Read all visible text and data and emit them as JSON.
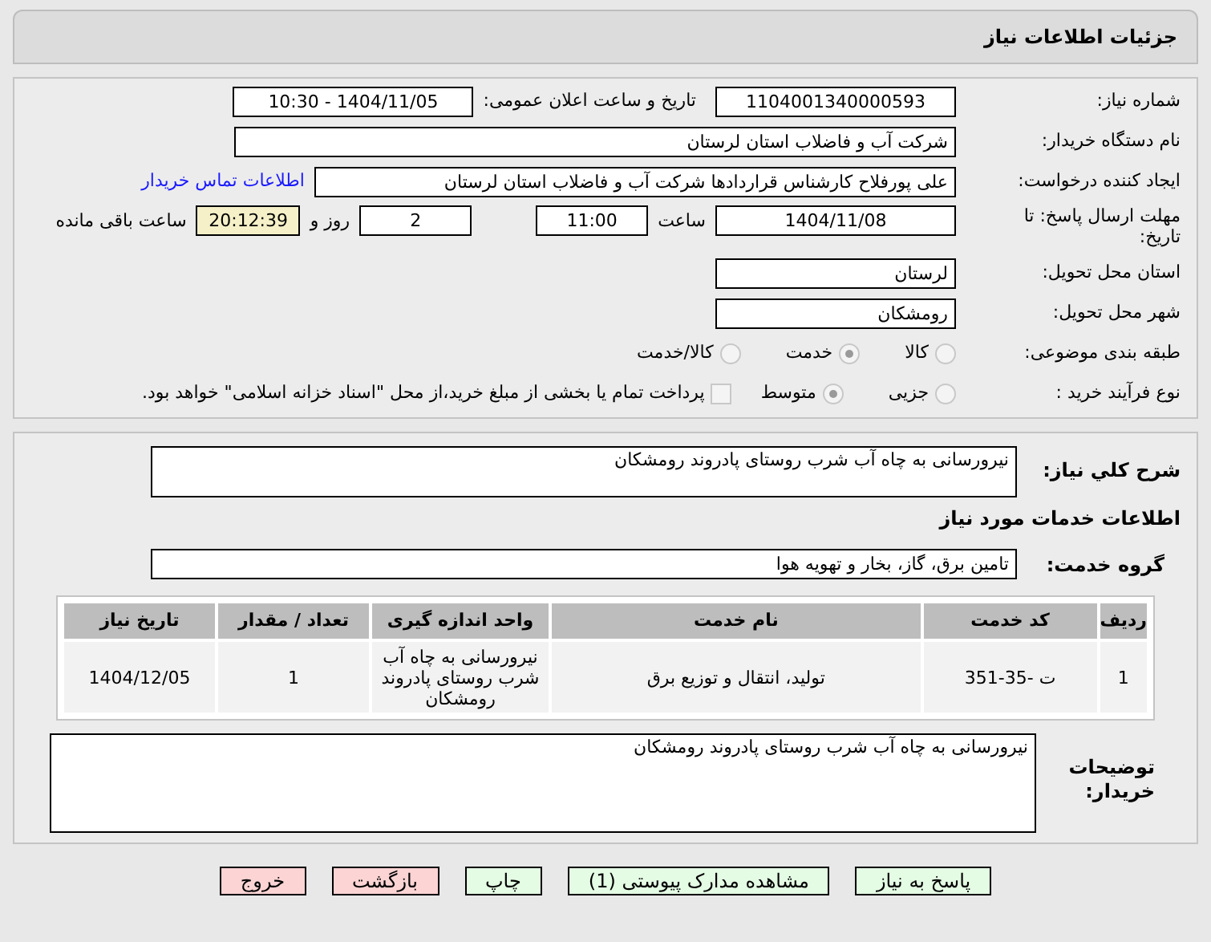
{
  "header": {
    "title": "جزئیات اطلاعات نیاز"
  },
  "fields": {
    "need_number": {
      "label": "شماره نیاز:",
      "value": "1104001340000593"
    },
    "announce": {
      "label": "تاریخ و ساعت اعلان عمومی:",
      "value": "1404/11/05 - 10:30"
    },
    "buyer": {
      "label": "نام دستگاه خریدار:",
      "value": "شرکت آب و فاضلاب استان لرستان"
    },
    "creator": {
      "label": "ایجاد کننده درخواست:",
      "value": "علی پورفلاح کارشناس قراردادها شرکت آب و فاضلاب استان لرستان",
      "link": "اطلاعات تماس خریدار"
    },
    "deadline": {
      "label": "مهلت ارسال پاسخ: تا تاریخ:",
      "date": "1404/11/08",
      "time_label": "ساعت",
      "time": "11:00",
      "days": "2",
      "days_label": "روز و",
      "remaining": "20:12:39",
      "remaining_label": "ساعت باقی مانده"
    },
    "province": {
      "label": "استان محل تحویل:",
      "value": "لرستان"
    },
    "city": {
      "label": "شهر محل تحویل:",
      "value": "رومشکان"
    }
  },
  "category": {
    "label": "طبقه بندی موضوعی:",
    "options": [
      {
        "label": "کالا",
        "selected": false
      },
      {
        "label": "خدمت",
        "selected": true
      },
      {
        "label": "کالا/خدمت",
        "selected": false
      }
    ]
  },
  "process": {
    "label": "نوع فرآیند خرید :",
    "options": [
      {
        "label": "جزیی",
        "selected": false
      },
      {
        "label": "متوسط",
        "selected": true
      }
    ],
    "payment": {
      "checked": false,
      "text": "پرداخت تمام یا بخشی از مبلغ خرید،از محل \"اسناد خزانه اسلامی\" خواهد بود."
    }
  },
  "summary": {
    "label": "شرح کلي نیاز:",
    "value": "نیرورسانی به چاه آب شرب روستای پادروند رومشکان"
  },
  "services_title": "اطلاعات خدمات مورد نیاز",
  "service_group": {
    "label": "گروه خدمت:",
    "value": "تامین برق، گاز، بخار و تهویه هوا"
  },
  "table": {
    "columns": [
      "ردیف",
      "کد خدمت",
      "نام خدمت",
      "واحد اندازه گیری",
      "تعداد / مقدار",
      "تاریخ نیاز"
    ],
    "rows": [
      [
        "1",
        "ت -35-351",
        "تولید، انتقال و توزیع برق",
        "نیرورسانی به چاه آب شرب روستای پادروند رومشکان",
        "1",
        "1404/12/05"
      ]
    ]
  },
  "buyer_notes": {
    "label": "توضیحات خریدار:",
    "value": "نیرورسانی به چاه آب شرب روستای پادروند رومشکان"
  },
  "buttons": [
    {
      "label": "پاسخ به نیاز",
      "kind": "green"
    },
    {
      "label": "مشاهده مدارک پیوستی (1)",
      "kind": "green"
    },
    {
      "label": "چاپ",
      "kind": "green"
    },
    {
      "label": "بازگشت",
      "kind": "red"
    },
    {
      "label": "خروج",
      "kind": "red"
    }
  ]
}
